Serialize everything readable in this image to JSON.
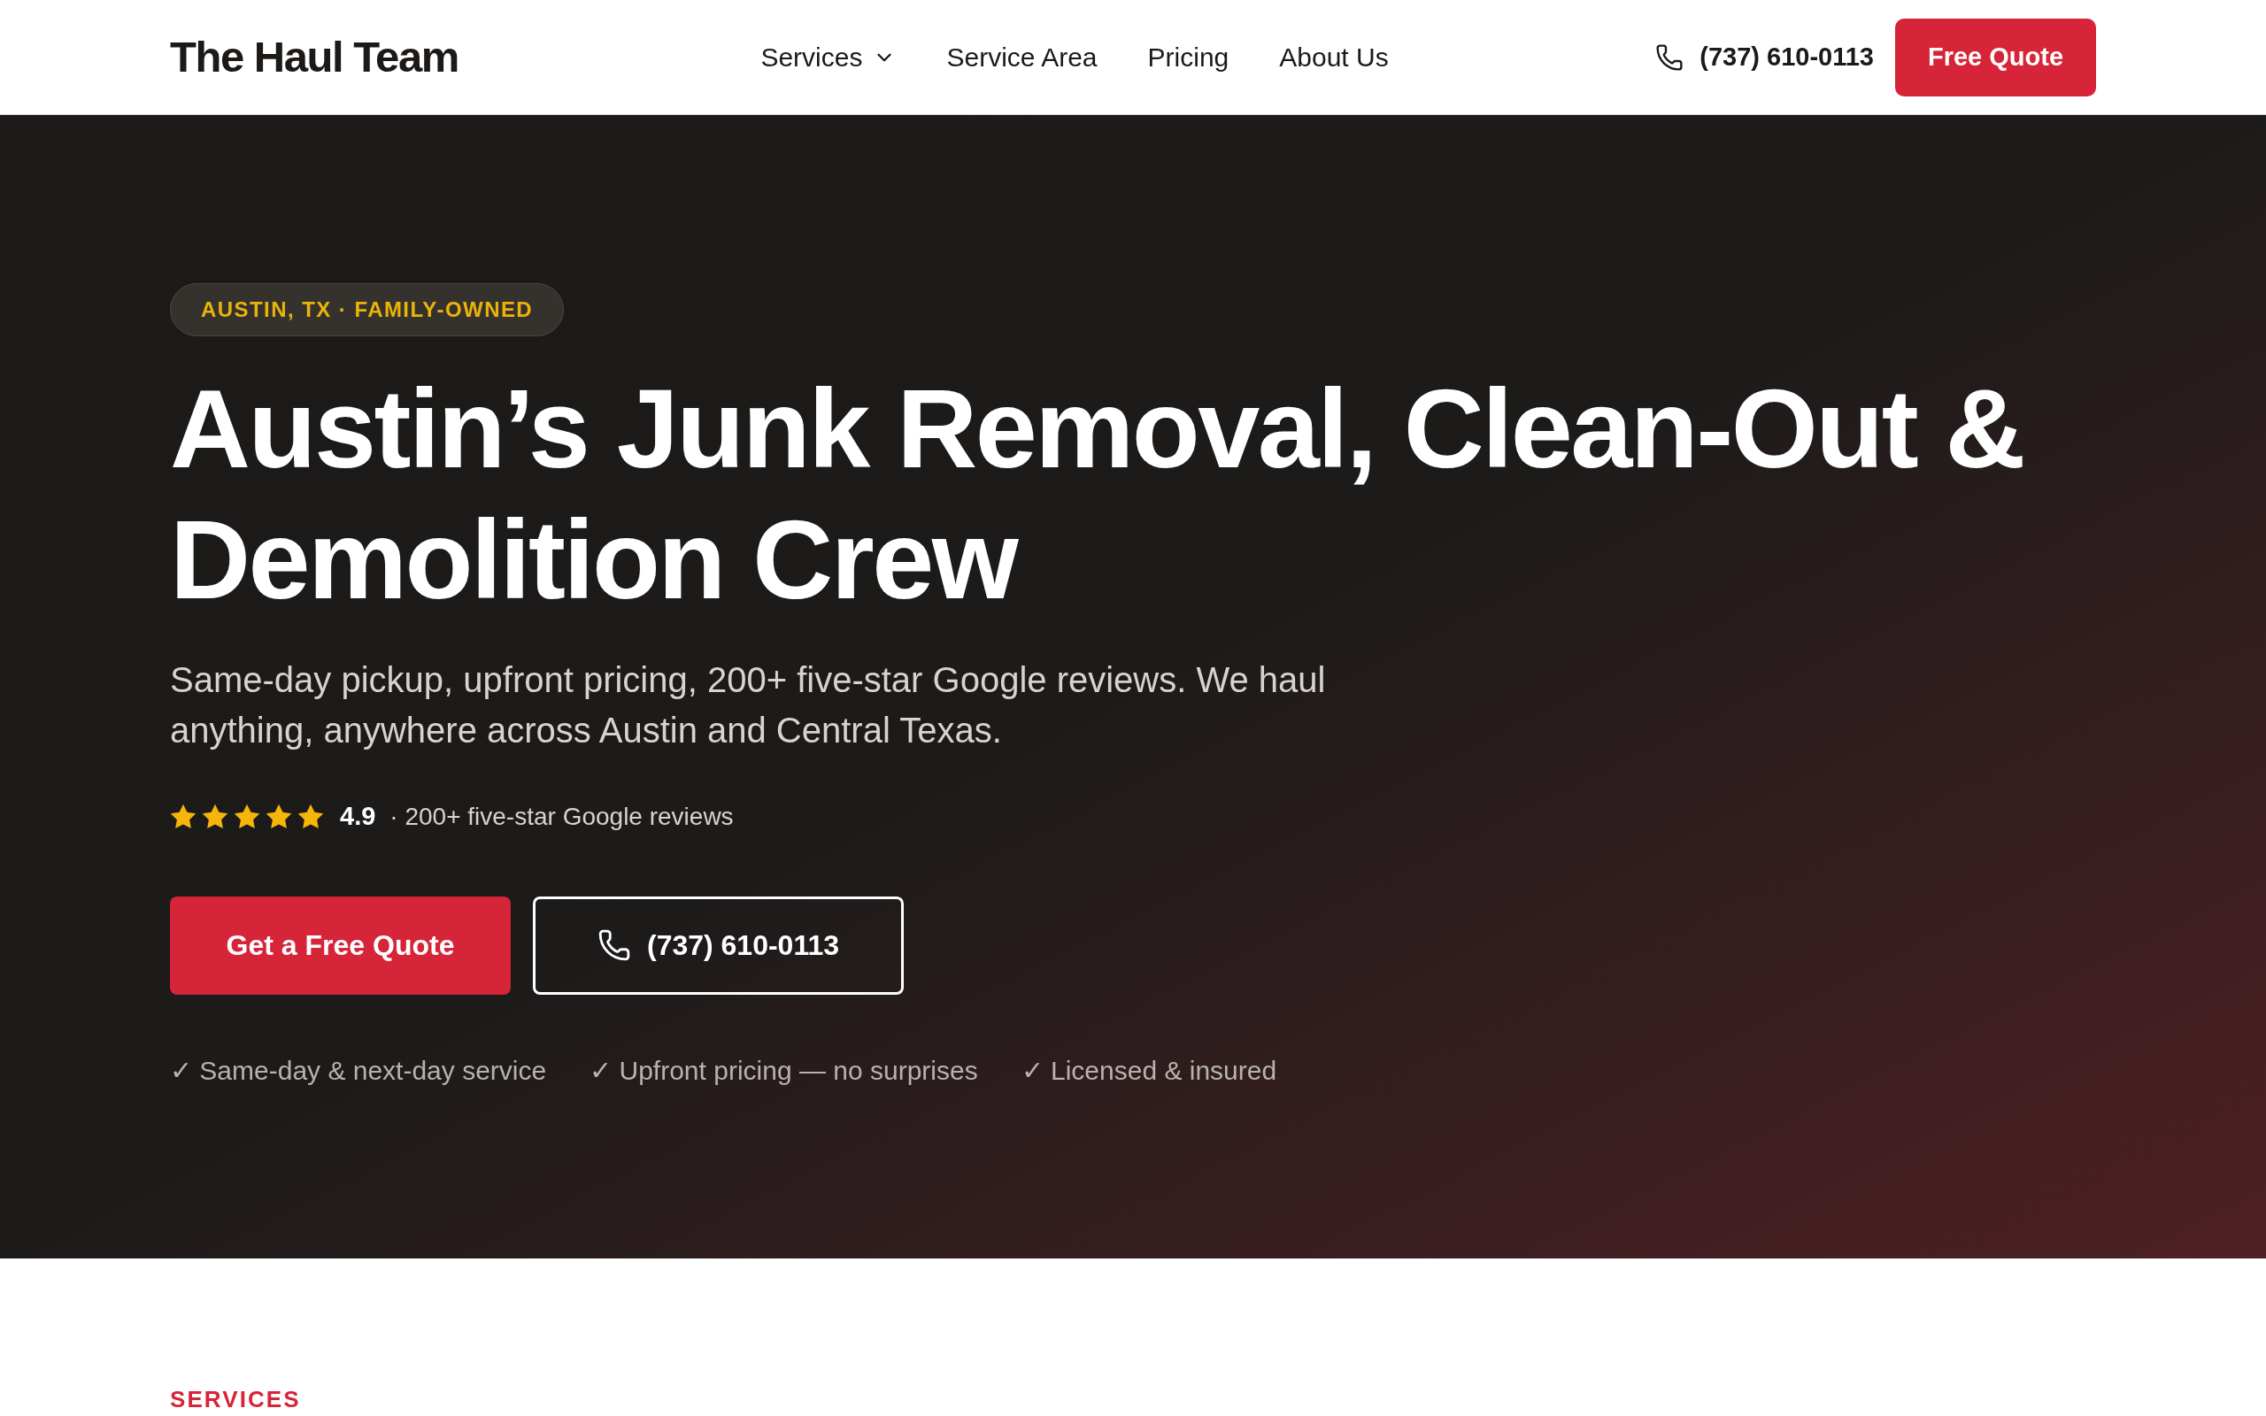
{
  "header": {
    "logo": "The Haul Team",
    "nav": [
      {
        "label": "Services",
        "kind": "dropdown"
      },
      {
        "label": "Service Area",
        "kind": "link"
      },
      {
        "label": "Pricing",
        "kind": "link"
      },
      {
        "label": "About Us",
        "kind": "link"
      }
    ],
    "phone": "(737) 610-0113",
    "cta": "Free Quote"
  },
  "hero": {
    "badge": "AUSTIN, TX · FAMILY-OWNED",
    "title": "Austin’s Junk Removal, Clean-Out & Demolition Crew",
    "subtitle": "Same-day pickup, upfront pricing, 200+ five-star Google reviews. We haul anything, anywhere across Austin and Central Texas.",
    "rating": {
      "stars": 5,
      "score": "4.9",
      "caption": "· 200+ five-star Google reviews"
    },
    "buttons": [
      {
        "label": "Get a Free Quote",
        "kind": "primary"
      },
      {
        "label": "(737) 610-0113",
        "kind": "phone"
      }
    ],
    "highlights": [
      "✓ Same-day & next-day service",
      "✓ Upfront pricing — no surprises",
      "✓ Licensed & insured"
    ]
  },
  "services_section": {
    "eyebrow": "SERVICES"
  }
}
